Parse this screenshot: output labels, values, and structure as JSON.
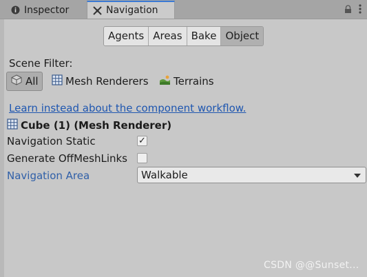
{
  "tabs": {
    "inspector": "Inspector",
    "navigation": "Navigation"
  },
  "segments": [
    "Agents",
    "Areas",
    "Bake",
    "Object"
  ],
  "selected_segment": "Object",
  "scene_filter": {
    "label": "Scene Filter:",
    "all": "All",
    "mesh_renderers": "Mesh Renderers",
    "terrains": "Terrains"
  },
  "link_text": "Learn instead about the component workflow.",
  "object_title": "Cube (1) (Mesh Renderer)",
  "properties": {
    "navigation_static": "Navigation Static",
    "navigation_static_checked": true,
    "generate_offmeshlinks": "Generate OffMeshLinks",
    "generate_offmeshlinks_checked": false,
    "navigation_area": "Navigation Area",
    "navigation_area_value": "Walkable"
  },
  "watermark": "CSDN @@Sunset...",
  "colors": {
    "accent": "#3a79d4",
    "link": "#1e56b0",
    "label_blue": "#2f5fa8"
  }
}
